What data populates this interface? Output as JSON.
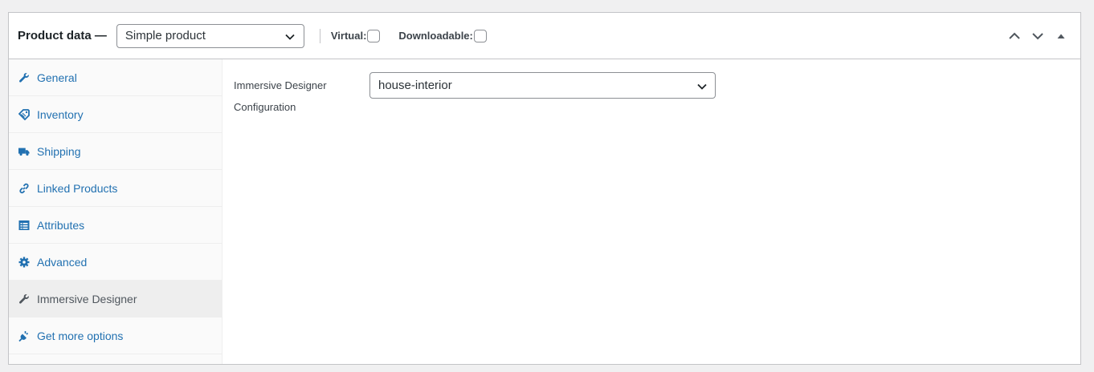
{
  "header": {
    "title": "Product data —",
    "product_type": "Simple product",
    "virtual_label": "Virtual:",
    "virtual_checked": false,
    "downloadable_label": "Downloadable:",
    "downloadable_checked": false
  },
  "sidebar": {
    "items": [
      {
        "label": "General",
        "icon": "wrench-icon"
      },
      {
        "label": "Inventory",
        "icon": "tag-icon"
      },
      {
        "label": "Shipping",
        "icon": "truck-icon"
      },
      {
        "label": "Linked Products",
        "icon": "link-icon"
      },
      {
        "label": "Attributes",
        "icon": "list-icon"
      },
      {
        "label": "Advanced",
        "icon": "gear-icon"
      },
      {
        "label": "Immersive Designer",
        "icon": "wrench-icon",
        "active": true
      },
      {
        "label": "Get more options",
        "icon": "plugin-icon"
      }
    ]
  },
  "main": {
    "field_label": "Immersive Designer Configuration",
    "config_value": "house-interior"
  },
  "colors": {
    "link": "#2271b1",
    "border": "#c3c4c7",
    "active_tab_bg": "#eeeeee"
  }
}
